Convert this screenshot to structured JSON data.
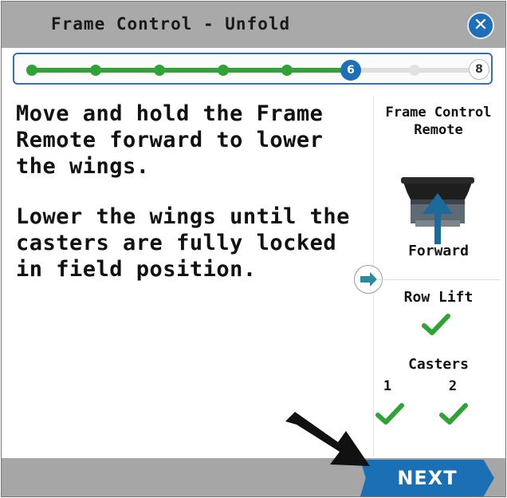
{
  "header": {
    "title": "Frame Control - Unfold",
    "close_icon": "close-icon"
  },
  "progress": {
    "total_steps": 8,
    "current_step": 6,
    "current_label": "6",
    "last_label": "8",
    "done_color": "#2fa336",
    "current_color": "#1d6fb8"
  },
  "instructions": {
    "paragraph1": "Move and hold the Frame Remote forward to lower the wings.",
    "paragraph2": "Lower the wings until the casters are fully locked in field position."
  },
  "side_panel": {
    "remote_title": "Frame Control Remote",
    "remote_icon": "frame-remote-icon",
    "forward_label": "Forward",
    "row_lift_label": "Row Lift",
    "row_lift_status": "check-icon",
    "casters_label": "Casters",
    "caster_1_label": "1",
    "caster_2_label": "2",
    "caster_1_status": "check-icon",
    "caster_2_status": "check-icon",
    "expand_icon": "arrow-right-icon"
  },
  "footer": {
    "next_label": "NEXT",
    "accent_color": "#1b6fb5"
  }
}
